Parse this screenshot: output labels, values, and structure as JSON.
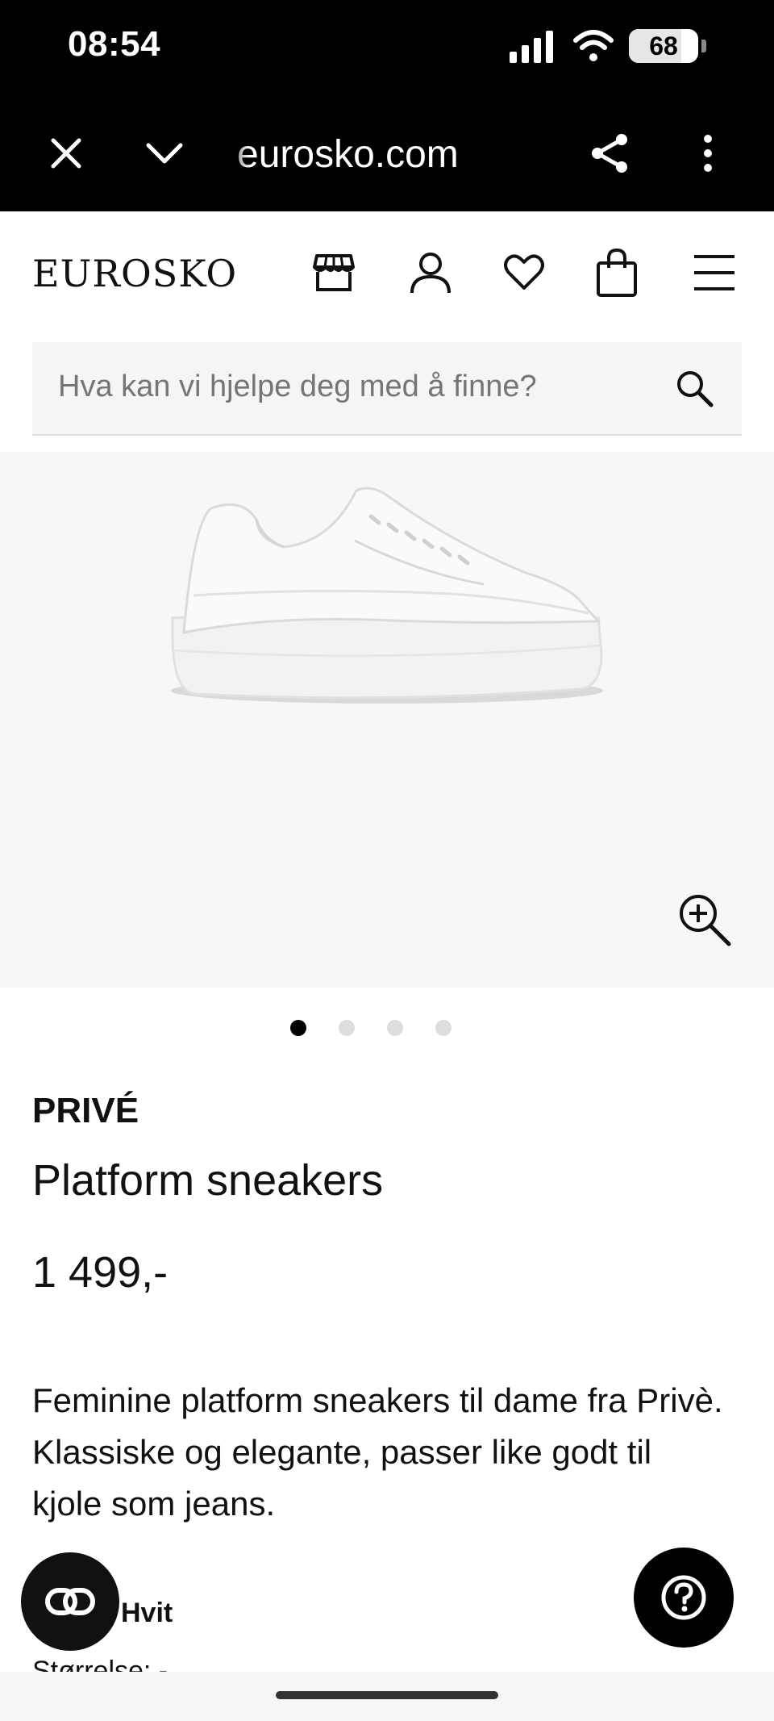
{
  "status_bar": {
    "time": "08:54",
    "battery": "68",
    "icons": [
      "cellular-signal-icon",
      "wifi-icon",
      "battery-icon"
    ]
  },
  "browser": {
    "url": "eurosko.com",
    "icons": [
      "close-icon",
      "chevron-down-icon",
      "share-icon",
      "more-vertical-icon"
    ]
  },
  "header": {
    "logo": "EUROSKO",
    "icons": [
      "store-icon",
      "account-icon",
      "heart-icon",
      "shopping-bag-icon",
      "menu-icon"
    ]
  },
  "search": {
    "placeholder": "Hva kan vi hjelpe deg med å finne?",
    "value": ""
  },
  "gallery": {
    "image_count": 4,
    "active_index": 0
  },
  "product": {
    "brand": "PRIVÉ",
    "name": "Platform sneakers",
    "price": "1 499,-",
    "description": "Feminine platform sneakers til dame fra Privè. Klassiske og elegante, passer like godt til kjole som jeans.",
    "color": "Hvit",
    "size_label": "Størrelse: -"
  },
  "colors": {
    "background": "#ffffff",
    "status_bar": "#000000",
    "image_bg": "#f8f7f5",
    "search_bg": "#f5f5f5",
    "dot_active": "#000000",
    "dot_inactive": "#dddddd"
  }
}
